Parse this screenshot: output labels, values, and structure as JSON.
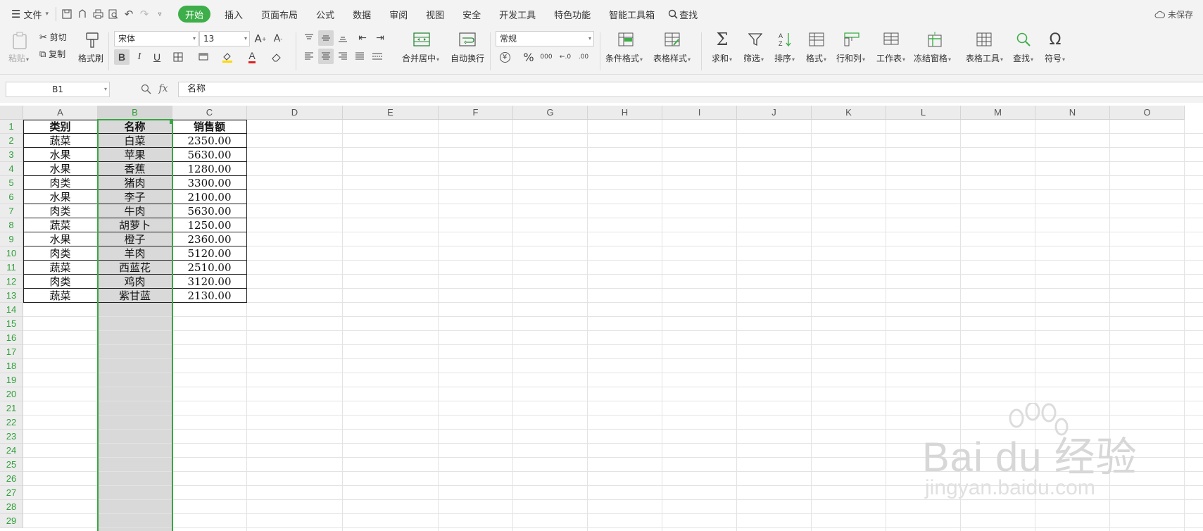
{
  "menubar": {
    "file_label": "文件",
    "tabs": [
      {
        "label": "开始",
        "active": true
      },
      {
        "label": "插入"
      },
      {
        "label": "页面布局"
      },
      {
        "label": "公式"
      },
      {
        "label": "数据"
      },
      {
        "label": "审阅"
      },
      {
        "label": "视图"
      },
      {
        "label": "安全"
      },
      {
        "label": "开发工具"
      },
      {
        "label": "特色功能"
      },
      {
        "label": "智能工具箱"
      }
    ],
    "search_label": "查找",
    "unsaved_label": "未保存",
    "accent_color": "#3dae49"
  },
  "ribbon": {
    "paste_label": "粘贴",
    "cut_label": "剪切",
    "copy_label": "复制",
    "format_painter_label": "格式刷",
    "font_name": "宋体",
    "font_size": "13",
    "merge_center_label": "合并居中",
    "wrap_text_label": "自动换行",
    "number_format": "常规",
    "conditional_format_label": "条件格式",
    "table_style_label": "表格样式",
    "sum_label": "求和",
    "filter_label": "筛选",
    "sort_label": "排序",
    "format_label": "格式",
    "row_col_label": "行和列",
    "worksheet_label": "工作表",
    "freeze_label": "冻结窗格",
    "table_tools_label": "表格工具",
    "find_label": "查找",
    "symbol_label": "符号",
    "percent_symbol": "%",
    "thousands_symbol": "000",
    "inc_decimal": "←.0",
    "dec_decimal": ".00",
    "currency_symbol": "¥"
  },
  "formulabar": {
    "cell_ref": "B1",
    "fx_label": "fx",
    "formula": "名称"
  },
  "sheet": {
    "columns": [
      "A",
      "B",
      "C",
      "D",
      "E",
      "F",
      "G",
      "H",
      "I",
      "J",
      "K",
      "L",
      "M",
      "N",
      "O"
    ],
    "selected_column": "B",
    "rows": [
      "1",
      "2",
      "3",
      "4",
      "5",
      "6",
      "7",
      "8",
      "9",
      "10",
      "11",
      "12",
      "13",
      "14",
      "15",
      "16",
      "17",
      "18",
      "19",
      "20",
      "21",
      "22",
      "23",
      "24",
      "25",
      "26",
      "27",
      "28",
      "29"
    ],
    "table": {
      "headers": [
        "类别",
        "名称",
        "销售额"
      ],
      "data": [
        [
          "蔬菜",
          "白菜",
          "2350.00"
        ],
        [
          "水果",
          "苹果",
          "5630.00"
        ],
        [
          "水果",
          "香蕉",
          "1280.00"
        ],
        [
          "肉类",
          "猪肉",
          "3300.00"
        ],
        [
          "水果",
          "李子",
          "2100.00"
        ],
        [
          "肉类",
          "牛肉",
          "5630.00"
        ],
        [
          "蔬菜",
          "胡萝卜",
          "1250.00"
        ],
        [
          "水果",
          "橙子",
          "2360.00"
        ],
        [
          "肉类",
          "羊肉",
          "5120.00"
        ],
        [
          "蔬菜",
          "西蓝花",
          "2510.00"
        ],
        [
          "肉类",
          "鸡肉",
          "3120.00"
        ],
        [
          "蔬菜",
          "紫甘蓝",
          "2130.00"
        ]
      ]
    }
  },
  "watermark": {
    "brand": "Bai du 经验",
    "url": "jingyan.baidu.com"
  }
}
